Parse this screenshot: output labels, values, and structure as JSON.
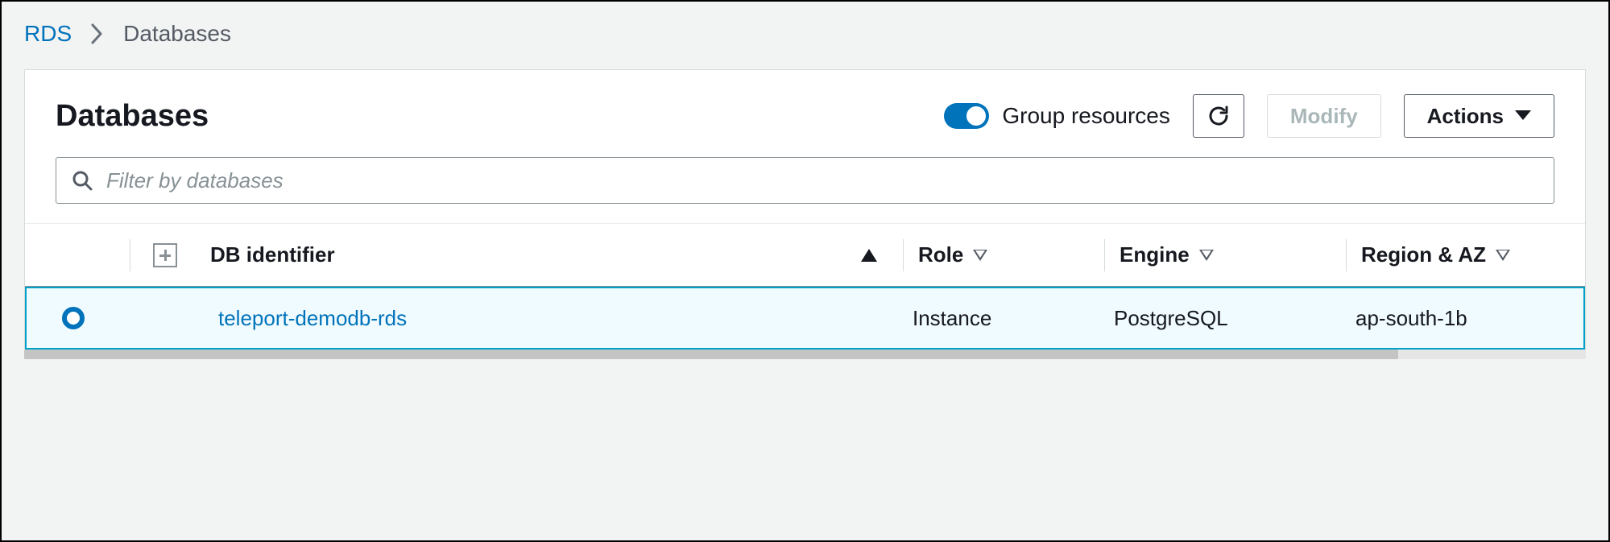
{
  "breadcrumb": {
    "service": "RDS",
    "current": "Databases"
  },
  "panel": {
    "title": "Databases",
    "group_toggle_label": "Group resources",
    "modify_label": "Modify",
    "actions_label": "Actions"
  },
  "filter": {
    "placeholder": "Filter by databases"
  },
  "table": {
    "columns": {
      "db_identifier": "DB identifier",
      "role": "Role",
      "engine": "Engine",
      "region_az": "Region & AZ"
    },
    "rows": [
      {
        "db_identifier": "teleport-demodb-rds",
        "role": "Instance",
        "engine": "PostgreSQL",
        "region_az": "ap-south-1b"
      }
    ]
  }
}
